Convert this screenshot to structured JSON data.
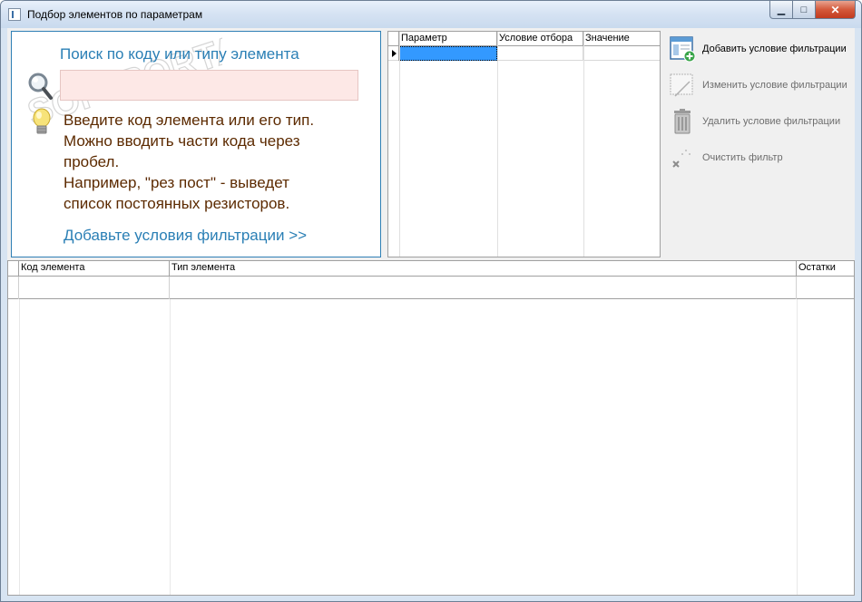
{
  "window": {
    "title": "Подбор элементов по параметрам",
    "min_glyph": "▁",
    "max_glyph": "□",
    "close_glyph": "✕"
  },
  "search": {
    "title": "Поиск по коду или типу элемента",
    "value": "",
    "hint_lines": [
      "Введите код элемента или его тип.",
      "Можно вводить части кода через",
      "пробел.",
      "Например, \"рез пост\" - выведет",
      "список постоянных резисторов."
    ],
    "add_link": "Добавьте условия фильтрации >>"
  },
  "filter_grid": {
    "columns": [
      "Параметр",
      "Условие отбора",
      "Значение"
    ],
    "rows": [
      [
        "",
        "",
        ""
      ]
    ]
  },
  "actions": {
    "add": "Добавить условие фильтрации",
    "edit": "Изменить условие фильтрации",
    "delete": "Удалить условие фильтрации",
    "clear": "Очистить фильтр"
  },
  "results_grid": {
    "columns": [
      "Код элемента",
      "Тип элемента",
      "Остатки"
    ],
    "rows": [
      [
        "",
        "",
        ""
      ]
    ]
  },
  "watermark": "SOFTPORTAL",
  "colors": {
    "accent": "#2a7fb5",
    "hint_text": "#5c2a00",
    "input_bg": "#fde8e6",
    "selection": "#3399ff"
  }
}
